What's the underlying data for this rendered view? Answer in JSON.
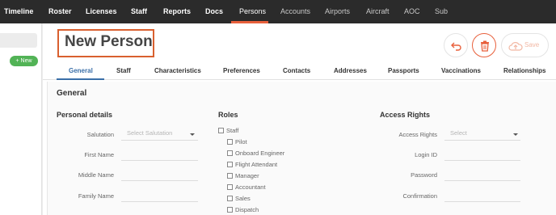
{
  "topnav": {
    "items": [
      "Timeline",
      "Roster",
      "Licenses",
      "Staff",
      "Reports",
      "Docs",
      "Persons",
      "Accounts",
      "Airports",
      "Aircraft",
      "AOC",
      "Sub"
    ],
    "active": "Persons",
    "accent_color": "#e8603c"
  },
  "sidebar": {
    "new_label": "New",
    "new_icon": "plus-icon"
  },
  "page": {
    "title": "New Person",
    "save_label": "Save"
  },
  "tabs": [
    "General",
    "Staff",
    "Characteristics",
    "Preferences",
    "Contacts",
    "Addresses",
    "Passports",
    "Vaccinations",
    "Relationships"
  ],
  "active_tab": "General",
  "general": {
    "heading": "General",
    "personal": {
      "title": "Personal details",
      "salutation_label": "Salutation",
      "salutation_placeholder": "Select Salutation",
      "first_name_label": "First Name",
      "middle_name_label": "Middle Name",
      "family_name_label": "Family Name"
    },
    "roles": {
      "title": "Roles",
      "items": [
        "Staff",
        "Pilot",
        "Onboard Engineer",
        "Flight Attendant",
        "Manager",
        "Accountant",
        "Sales",
        "Dispatch"
      ]
    },
    "access": {
      "title": "Access Rights",
      "access_rights_label": "Access Rights",
      "access_rights_placeholder": "Select",
      "login_id_label": "Login ID",
      "password_label": "Password",
      "confirmation_label": "Confirmation"
    }
  }
}
